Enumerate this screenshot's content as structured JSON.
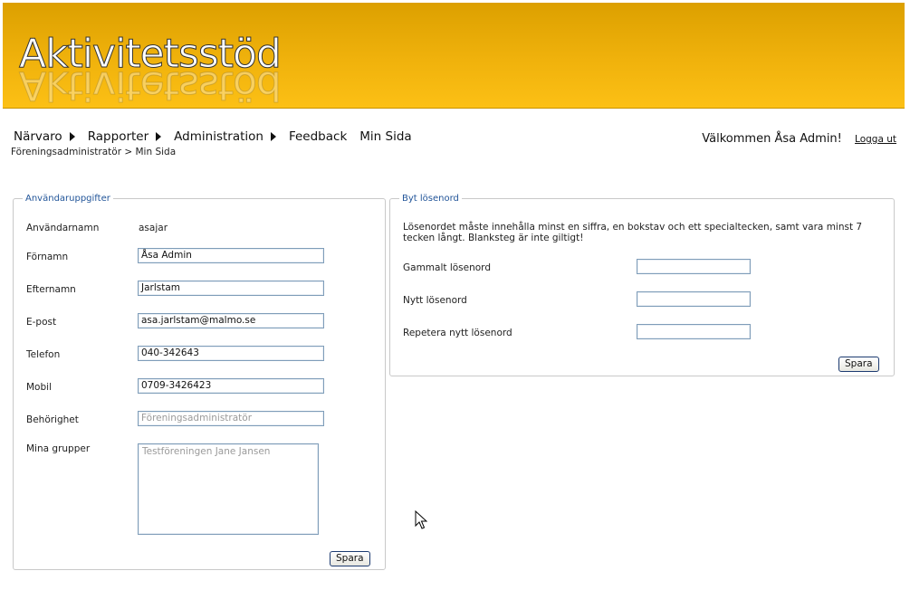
{
  "header": {
    "logo_text": "Aktivitetsstöd"
  },
  "nav": {
    "items": [
      {
        "label": "Närvaro",
        "has_arrow": true
      },
      {
        "label": "Rapporter",
        "has_arrow": true
      },
      {
        "label": "Administration",
        "has_arrow": true
      },
      {
        "label": "Feedback",
        "has_arrow": false
      },
      {
        "label": "Min Sida",
        "has_arrow": false
      }
    ],
    "breadcrumb": "Föreningsadministratör > Min Sida"
  },
  "welcome": {
    "prefix": "Välkommen",
    "user_name": "Åsa Admin",
    "suffix": "!",
    "logout_label": "Logga ut"
  },
  "user_details": {
    "legend": "Användaruppgifter",
    "username_label": "Användarnamn",
    "username_value": "asajar",
    "firstname_label": "Förnamn",
    "firstname_value": "Åsa Admin",
    "lastname_label": "Efternamn",
    "lastname_value": "Jarlstam",
    "email_label": "E-post",
    "email_value": "asa.jarlstam@malmo.se",
    "phone_label": "Telefon",
    "phone_value": "040-342643",
    "mobile_label": "Mobil",
    "mobile_value": "0709-3426423",
    "role_label": "Behörighet",
    "role_value": "Föreningsadministratör",
    "groups_label": "Mina grupper",
    "groups_value": "Testföreningen Jane Jansen",
    "save_label": "Spara"
  },
  "change_password": {
    "legend": "Byt lösenord",
    "hint": "Lösenordet måste innehålla minst en siffra, en bokstav och ett specialtecken, samt vara minst 7 tecken långt. Blanksteg är inte giltigt!",
    "old_label": "Gammalt lösenord",
    "new_label": "Nytt lösenord",
    "repeat_label": "Repetera nytt lösenord",
    "save_label": "Spara"
  },
  "icons": {
    "nav_arrow": "triangle-right-icon",
    "cursor": "mouse-pointer-icon"
  }
}
